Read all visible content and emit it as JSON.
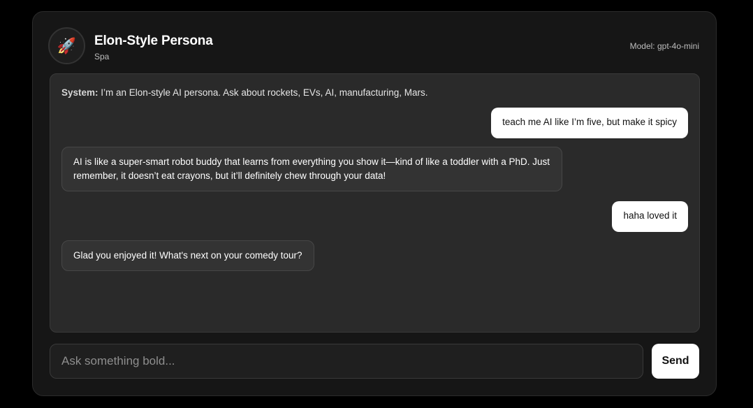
{
  "header": {
    "avatar_icon": "rocket-icon",
    "avatar_glyph": "🚀",
    "title": "Elon-Style Persona",
    "subtitle": "Spa",
    "model_label": "Model: gpt-4o-mini"
  },
  "chat": {
    "system_label": "System:",
    "system_text": " I’m an Elon-style AI persona. Ask about rockets, EVs, AI, manufacturing, Mars.",
    "messages": [
      {
        "role": "user",
        "text": "teach me AI like I’m five, but make it spicy"
      },
      {
        "role": "assistant",
        "text": "AI is like a super-smart robot buddy that learns from everything you show it—kind of like a toddler with a PhD. Just remember, it doesn’t eat crayons, but it’ll definitely chew through your data!"
      },
      {
        "role": "user",
        "text": "haha loved it"
      },
      {
        "role": "assistant",
        "text": "Glad you enjoyed it! What's next on your comedy tour?"
      }
    ]
  },
  "composer": {
    "placeholder": "Ask something bold...",
    "value": "",
    "send_label": "Send"
  },
  "colors": {
    "background": "#000000",
    "card": "#161616",
    "chat_panel": "#2a2a2a",
    "user_bubble": "#ffffff",
    "assistant_bubble": "#333333",
    "send_button": "#ffffff"
  }
}
